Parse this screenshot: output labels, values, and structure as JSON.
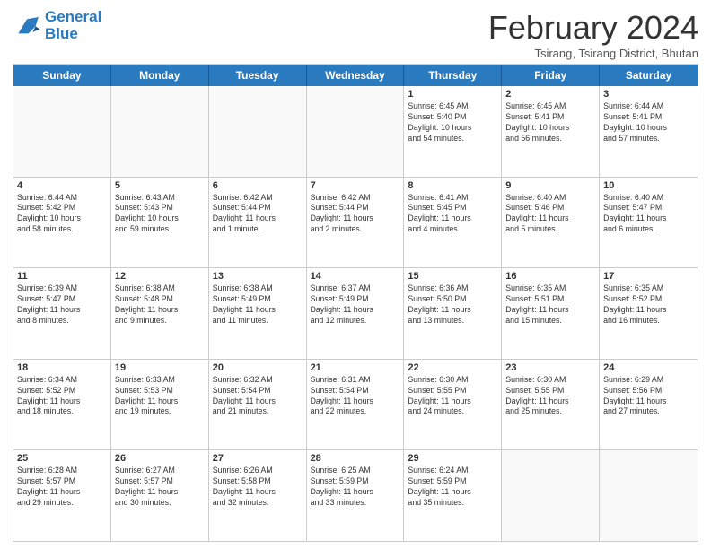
{
  "header": {
    "logo_line1": "General",
    "logo_line2": "Blue",
    "month": "February 2024",
    "location": "Tsirang, Tsirang District, Bhutan"
  },
  "days_of_week": [
    "Sunday",
    "Monday",
    "Tuesday",
    "Wednesday",
    "Thursday",
    "Friday",
    "Saturday"
  ],
  "weeks": [
    [
      {
        "day": "",
        "info": "",
        "empty": true
      },
      {
        "day": "",
        "info": "",
        "empty": true
      },
      {
        "day": "",
        "info": "",
        "empty": true
      },
      {
        "day": "",
        "info": "",
        "empty": true
      },
      {
        "day": "1",
        "info": "Sunrise: 6:45 AM\nSunset: 5:40 PM\nDaylight: 10 hours\nand 54 minutes."
      },
      {
        "day": "2",
        "info": "Sunrise: 6:45 AM\nSunset: 5:41 PM\nDaylight: 10 hours\nand 56 minutes."
      },
      {
        "day": "3",
        "info": "Sunrise: 6:44 AM\nSunset: 5:41 PM\nDaylight: 10 hours\nand 57 minutes."
      }
    ],
    [
      {
        "day": "4",
        "info": "Sunrise: 6:44 AM\nSunset: 5:42 PM\nDaylight: 10 hours\nand 58 minutes."
      },
      {
        "day": "5",
        "info": "Sunrise: 6:43 AM\nSunset: 5:43 PM\nDaylight: 10 hours\nand 59 minutes."
      },
      {
        "day": "6",
        "info": "Sunrise: 6:42 AM\nSunset: 5:44 PM\nDaylight: 11 hours\nand 1 minute."
      },
      {
        "day": "7",
        "info": "Sunrise: 6:42 AM\nSunset: 5:44 PM\nDaylight: 11 hours\nand 2 minutes."
      },
      {
        "day": "8",
        "info": "Sunrise: 6:41 AM\nSunset: 5:45 PM\nDaylight: 11 hours\nand 4 minutes."
      },
      {
        "day": "9",
        "info": "Sunrise: 6:40 AM\nSunset: 5:46 PM\nDaylight: 11 hours\nand 5 minutes."
      },
      {
        "day": "10",
        "info": "Sunrise: 6:40 AM\nSunset: 5:47 PM\nDaylight: 11 hours\nand 6 minutes."
      }
    ],
    [
      {
        "day": "11",
        "info": "Sunrise: 6:39 AM\nSunset: 5:47 PM\nDaylight: 11 hours\nand 8 minutes."
      },
      {
        "day": "12",
        "info": "Sunrise: 6:38 AM\nSunset: 5:48 PM\nDaylight: 11 hours\nand 9 minutes."
      },
      {
        "day": "13",
        "info": "Sunrise: 6:38 AM\nSunset: 5:49 PM\nDaylight: 11 hours\nand 11 minutes."
      },
      {
        "day": "14",
        "info": "Sunrise: 6:37 AM\nSunset: 5:49 PM\nDaylight: 11 hours\nand 12 minutes."
      },
      {
        "day": "15",
        "info": "Sunrise: 6:36 AM\nSunset: 5:50 PM\nDaylight: 11 hours\nand 13 minutes."
      },
      {
        "day": "16",
        "info": "Sunrise: 6:35 AM\nSunset: 5:51 PM\nDaylight: 11 hours\nand 15 minutes."
      },
      {
        "day": "17",
        "info": "Sunrise: 6:35 AM\nSunset: 5:52 PM\nDaylight: 11 hours\nand 16 minutes."
      }
    ],
    [
      {
        "day": "18",
        "info": "Sunrise: 6:34 AM\nSunset: 5:52 PM\nDaylight: 11 hours\nand 18 minutes."
      },
      {
        "day": "19",
        "info": "Sunrise: 6:33 AM\nSunset: 5:53 PM\nDaylight: 11 hours\nand 19 minutes."
      },
      {
        "day": "20",
        "info": "Sunrise: 6:32 AM\nSunset: 5:54 PM\nDaylight: 11 hours\nand 21 minutes."
      },
      {
        "day": "21",
        "info": "Sunrise: 6:31 AM\nSunset: 5:54 PM\nDaylight: 11 hours\nand 22 minutes."
      },
      {
        "day": "22",
        "info": "Sunrise: 6:30 AM\nSunset: 5:55 PM\nDaylight: 11 hours\nand 24 minutes."
      },
      {
        "day": "23",
        "info": "Sunrise: 6:30 AM\nSunset: 5:55 PM\nDaylight: 11 hours\nand 25 minutes."
      },
      {
        "day": "24",
        "info": "Sunrise: 6:29 AM\nSunset: 5:56 PM\nDaylight: 11 hours\nand 27 minutes."
      }
    ],
    [
      {
        "day": "25",
        "info": "Sunrise: 6:28 AM\nSunset: 5:57 PM\nDaylight: 11 hours\nand 29 minutes."
      },
      {
        "day": "26",
        "info": "Sunrise: 6:27 AM\nSunset: 5:57 PM\nDaylight: 11 hours\nand 30 minutes."
      },
      {
        "day": "27",
        "info": "Sunrise: 6:26 AM\nSunset: 5:58 PM\nDaylight: 11 hours\nand 32 minutes."
      },
      {
        "day": "28",
        "info": "Sunrise: 6:25 AM\nSunset: 5:59 PM\nDaylight: 11 hours\nand 33 minutes."
      },
      {
        "day": "29",
        "info": "Sunrise: 6:24 AM\nSunset: 5:59 PM\nDaylight: 11 hours\nand 35 minutes."
      },
      {
        "day": "",
        "info": "",
        "empty": true
      },
      {
        "day": "",
        "info": "",
        "empty": true
      }
    ]
  ]
}
